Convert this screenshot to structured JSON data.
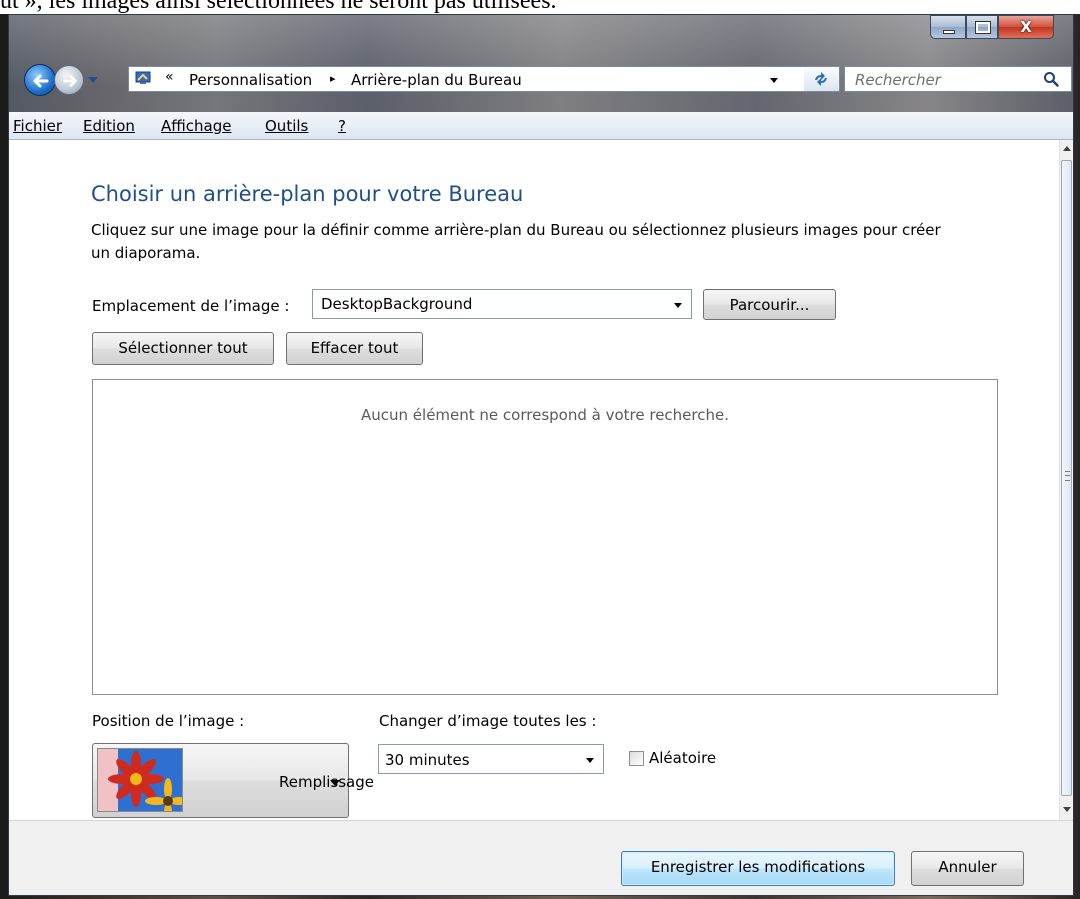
{
  "document_text": "ut », les images ainsi sélectionnées ne seront pas utilisées.",
  "window": {
    "controls": {
      "close_glyph": "X"
    }
  },
  "address": {
    "overflow": "«",
    "crumbs": [
      "Personnalisation",
      "Arrière-plan du Bureau"
    ],
    "separator": "▸"
  },
  "search": {
    "placeholder": "Rechercher"
  },
  "menu": [
    "Fichier",
    "Edition",
    "Affichage",
    "Outils",
    "?"
  ],
  "content": {
    "title": "Choisir un arrière-plan pour votre Bureau",
    "description_line1": "Cliquez sur une image pour la définir comme arrière-plan du Bureau ou sélectionnez plusieurs images pour créer",
    "description_line2": "un diaporama.",
    "location_label": "Emplacement de l’image :",
    "location_value": "DesktopBackground",
    "browse_label": "Parcourir...",
    "select_all_label": "Sélectionner tout",
    "clear_all_label": "Effacer tout",
    "empty_message": "Aucun élément ne correspond à votre recherche.",
    "position_label": "Position de l’image :",
    "position_value": "Remplissage",
    "interval_label": "Changer d’image toutes les :",
    "interval_value": "30 minutes",
    "shuffle_label": "Aléatoire"
  },
  "footer": {
    "save_label": "Enregistrer les modifications",
    "cancel_label": "Annuler"
  },
  "colors": {
    "title_blue": "#1e4e8c",
    "close_red": "#c1351f",
    "default_button_blue": "#3c7fb1"
  },
  "icons": {
    "back": "back-arrow-icon",
    "forward": "forward-arrow-icon",
    "refresh": "refresh-icon",
    "search": "search-icon",
    "folder": "personalization-icon"
  }
}
